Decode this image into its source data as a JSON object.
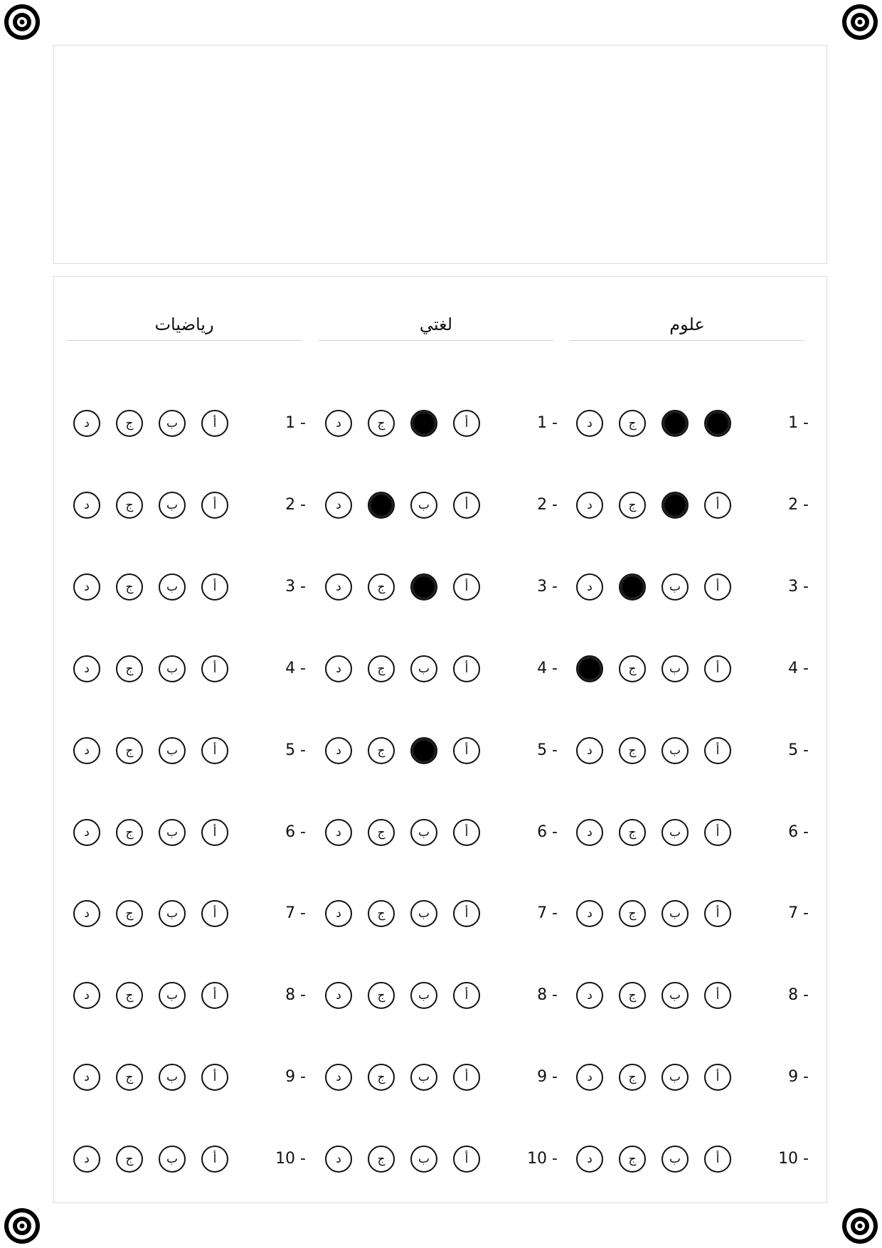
{
  "options": [
    "أ",
    "ب",
    "ج",
    "د"
  ],
  "sections": [
    {
      "title": "علوم",
      "questions": [
        {
          "number": "1 -",
          "selected": [
            0,
            1
          ]
        },
        {
          "number": "2 -",
          "selected": [
            1
          ]
        },
        {
          "number": "3 -",
          "selected": [
            2
          ]
        },
        {
          "number": "4 -",
          "selected": [
            3
          ]
        },
        {
          "number": "5 -",
          "selected": []
        },
        {
          "number": "6 -",
          "selected": []
        },
        {
          "number": "7 -",
          "selected": []
        },
        {
          "number": "8 -",
          "selected": []
        },
        {
          "number": "9 -",
          "selected": []
        },
        {
          "number": "10 -",
          "selected": []
        }
      ]
    },
    {
      "title": "لغتي",
      "questions": [
        {
          "number": "1 -",
          "selected": [
            1
          ]
        },
        {
          "number": "2 -",
          "selected": [
            2
          ]
        },
        {
          "number": "3 -",
          "selected": [
            1
          ]
        },
        {
          "number": "4 -",
          "selected": []
        },
        {
          "number": "5 -",
          "selected": [
            1
          ]
        },
        {
          "number": "6 -",
          "selected": []
        },
        {
          "number": "7 -",
          "selected": []
        },
        {
          "number": "8 -",
          "selected": []
        },
        {
          "number": "9 -",
          "selected": []
        },
        {
          "number": "10 -",
          "selected": []
        }
      ]
    },
    {
      "title": "رياضيات",
      "questions": [
        {
          "number": "1 -",
          "selected": []
        },
        {
          "number": "2 -",
          "selected": []
        },
        {
          "number": "3 -",
          "selected": []
        },
        {
          "number": "4 -",
          "selected": []
        },
        {
          "number": "5 -",
          "selected": []
        },
        {
          "number": "6 -",
          "selected": []
        },
        {
          "number": "7 -",
          "selected": []
        },
        {
          "number": "8 -",
          "selected": []
        },
        {
          "number": "9 -",
          "selected": []
        },
        {
          "number": "10 -",
          "selected": []
        }
      ]
    }
  ],
  "icons": {
    "registration_marker": "concentric-target-icon"
  },
  "colors": {
    "ink": "#111111",
    "border": "#dcdcdc",
    "rule": "#cfcfcf"
  }
}
